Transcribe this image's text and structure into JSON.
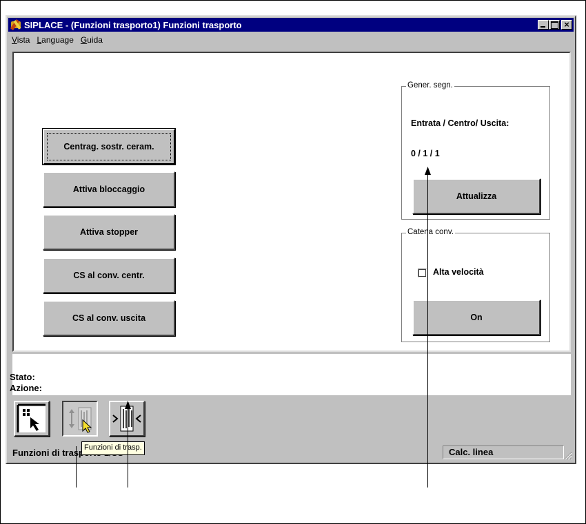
{
  "window": {
    "title": "SIPLACE - (Funzioni trasporto1) Funzioni trasporto",
    "icon": "siplace-app-icon"
  },
  "menu": {
    "items": [
      {
        "label": "Vista",
        "mnemonic": "V",
        "rest": "ista"
      },
      {
        "label": "Language",
        "mnemonic": "L",
        "rest": "anguage"
      },
      {
        "label": "Guida",
        "mnemonic": "G",
        "rest": "uida"
      }
    ]
  },
  "buttons": {
    "centrag": "Centrag. sostr. ceram.",
    "bloccaggio": "Attiva bloccaggio",
    "stopper": "Attiva stopper",
    "cs_centr": "CS al conv. centr.",
    "cs_uscita": "CS al conv. uscita"
  },
  "signal_group": {
    "legend": "Gener. segn.",
    "label": "Entrata / Centro/ Uscita:",
    "value": "0 / 1 / 1",
    "refresh_button": "Attualizza"
  },
  "chain_group": {
    "legend": "Catena conv.",
    "checkbox_label": "Alta velocità",
    "checkbox_checked": false,
    "on_button": "On"
  },
  "status": {
    "stato_label": "Stato:",
    "azione_label": "Azione:"
  },
  "toolbar": {
    "tools": [
      {
        "name": "select-tool-icon",
        "pressed": false
      },
      {
        "name": "transport-functions-icon",
        "pressed": true
      },
      {
        "name": "conveyor-width-icon",
        "pressed": false
      }
    ],
    "tooltip": "Funzioni di trasp."
  },
  "statusbar": {
    "left": "Funzioni di trasporto 1/SS",
    "right": "Calc. linea"
  }
}
